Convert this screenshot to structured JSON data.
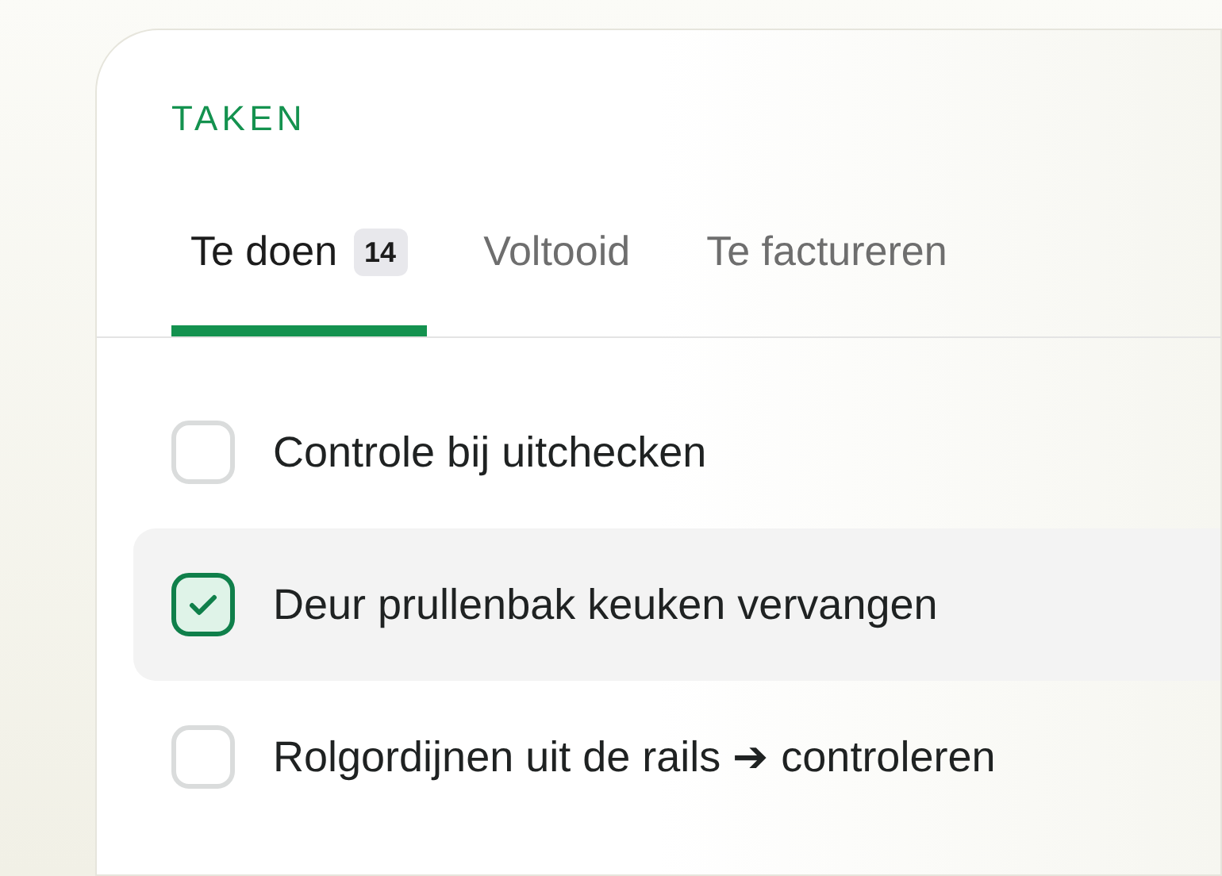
{
  "title": "TAKEN",
  "tabs": [
    {
      "label": "Te doen",
      "count": "14",
      "selected": true
    },
    {
      "label": "Voltooid",
      "selected": false
    },
    {
      "label": "Te factureren",
      "selected": false
    }
  ],
  "tasks": [
    {
      "label": "Controle bij uitchecken",
      "checked": false,
      "selected": false
    },
    {
      "label": "Deur prullenbak keuken vervangen",
      "checked": true,
      "selected": true
    },
    {
      "label": "Rolgordijnen uit de rails ➔ controleren",
      "checked": false,
      "selected": false
    }
  ]
}
